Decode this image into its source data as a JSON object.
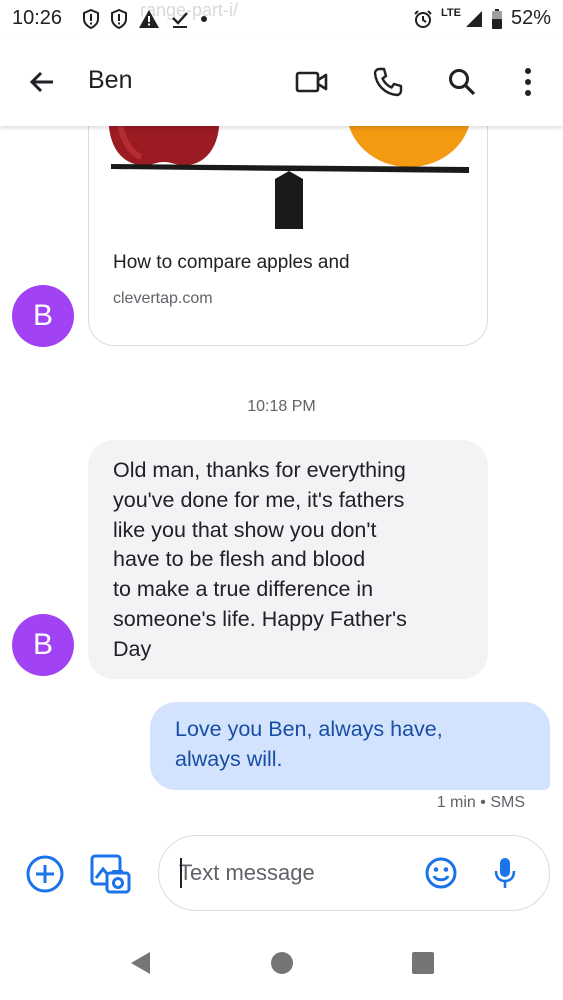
{
  "status_bar": {
    "time": "10:26",
    "network": "LTE",
    "battery": "52%",
    "faded_url": "range-part-i/"
  },
  "app_bar": {
    "contact_name": "Ben"
  },
  "conversation": {
    "link_preview": {
      "title": "How to compare apples and",
      "domain": "clevertap.com"
    },
    "avatar_letter": "B",
    "timestamp": "10:18 PM",
    "incoming_message": {
      "lines": [
        "Old man, thanks for everything",
        "you've done for me, it's fathers",
        "like you that show you don't",
        "have to be flesh and blood",
        "to make a true difference in",
        "someone's life. Happy Father's",
        "Day"
      ]
    },
    "outgoing_message": {
      "lines": [
        "Love you Ben, always have,",
        "always will."
      ],
      "meta": "1 min • SMS"
    }
  },
  "compose": {
    "placeholder": "Text message"
  },
  "colors": {
    "accent": "#1a73e8",
    "avatar": "#a142f4",
    "incoming_bubble": "#f1f3f4",
    "outgoing_bubble": "#d3e3fd",
    "outgoing_text": "#174ea6"
  },
  "icons": {
    "back": "arrow-back-icon",
    "video": "video-call-icon",
    "call": "phone-icon",
    "search": "search-icon",
    "more": "more-vert-icon",
    "add": "add-circle-icon",
    "gallery": "gallery-icon",
    "emoji": "emoji-icon",
    "mic": "mic-icon",
    "nav_back": "nav-back-icon",
    "nav_home": "nav-home-icon",
    "nav_recents": "nav-recents-icon"
  }
}
